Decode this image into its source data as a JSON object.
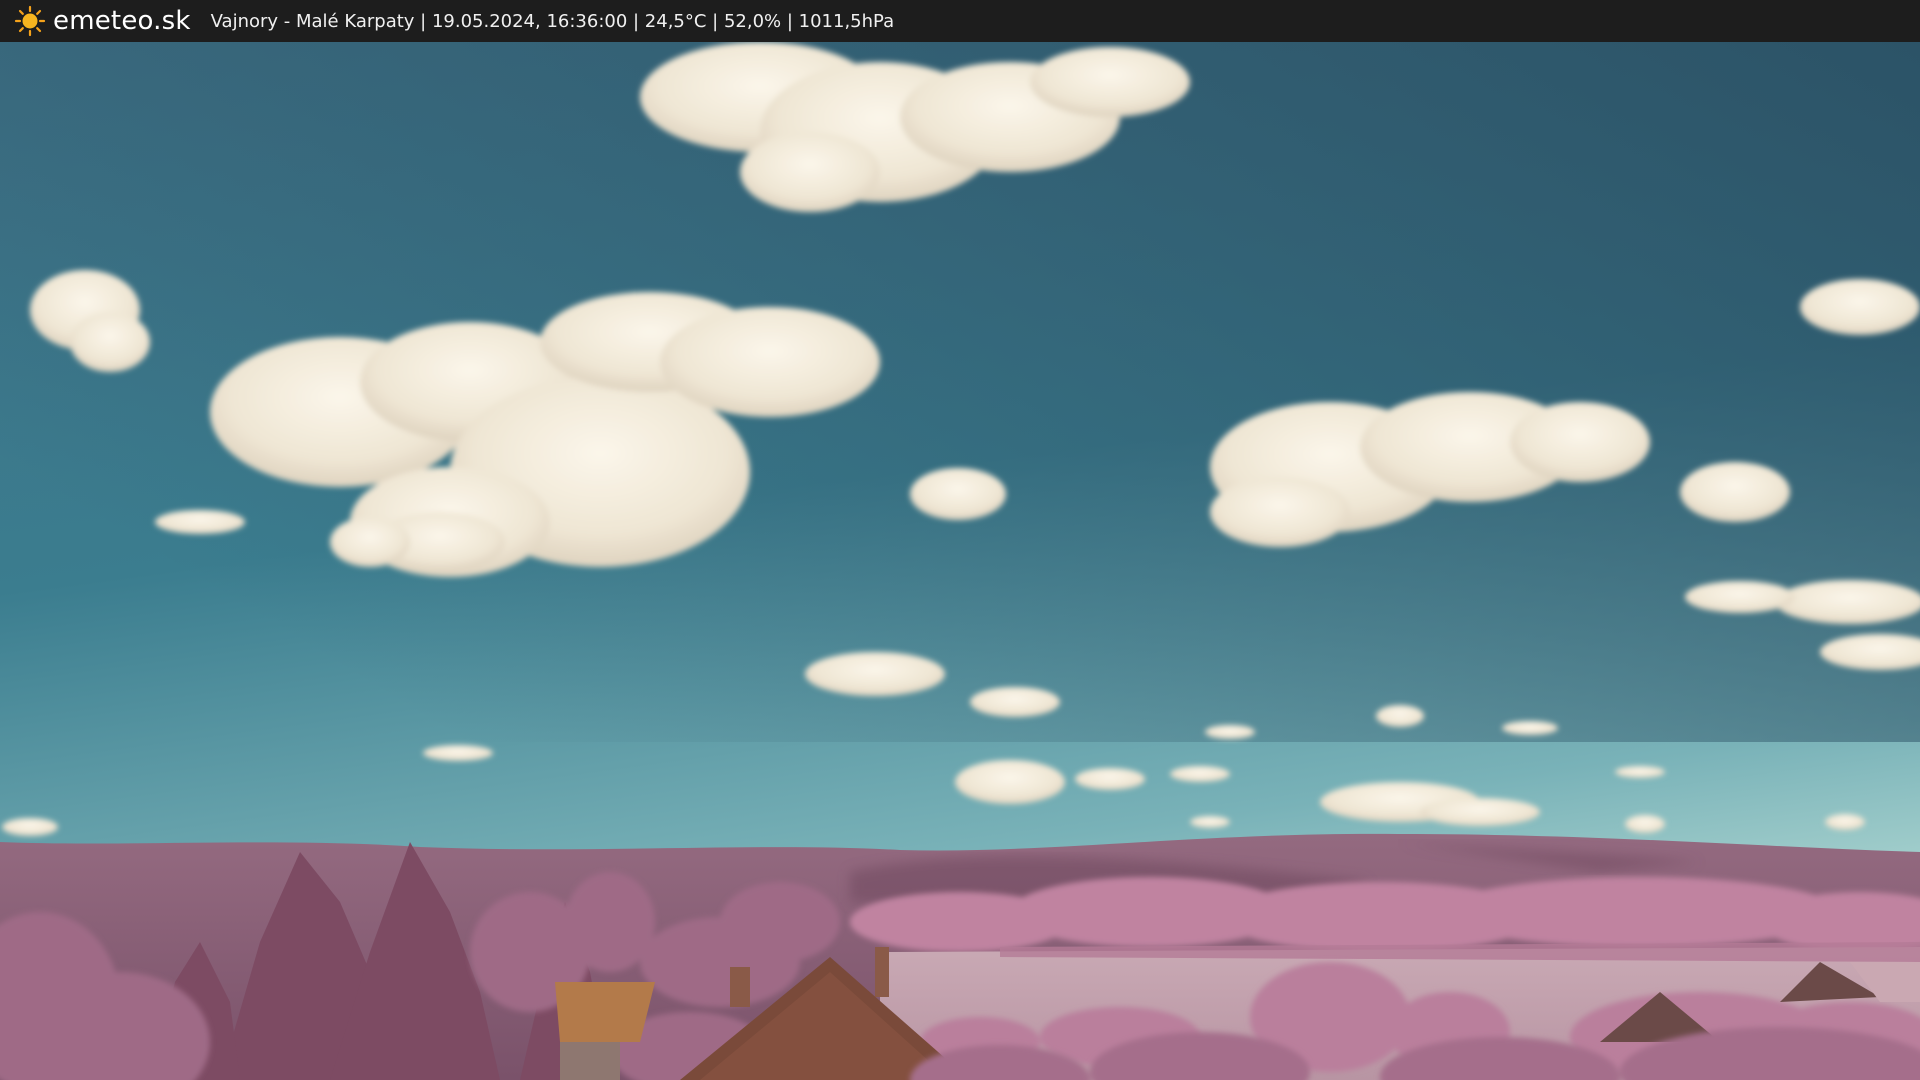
{
  "header": {
    "brand": "emeteo.sk",
    "caption": "Vajnory - Malé Karpaty | 19.05.2024, 16:36:00 | 24,5°C | 52,0% | 1011,5hPa",
    "logo_icon": "sun-icon"
  },
  "image": {
    "description_icon": "webcam-image",
    "colors": {
      "sky_top": "#2f5a6e",
      "sky_horizon": "#8fc2c4",
      "hills": "#8a5f77",
      "foliage": "#b77a98",
      "field": "#c8a6b2",
      "roof": "#7a4a3a",
      "cloud": "#f3ecdc"
    }
  }
}
